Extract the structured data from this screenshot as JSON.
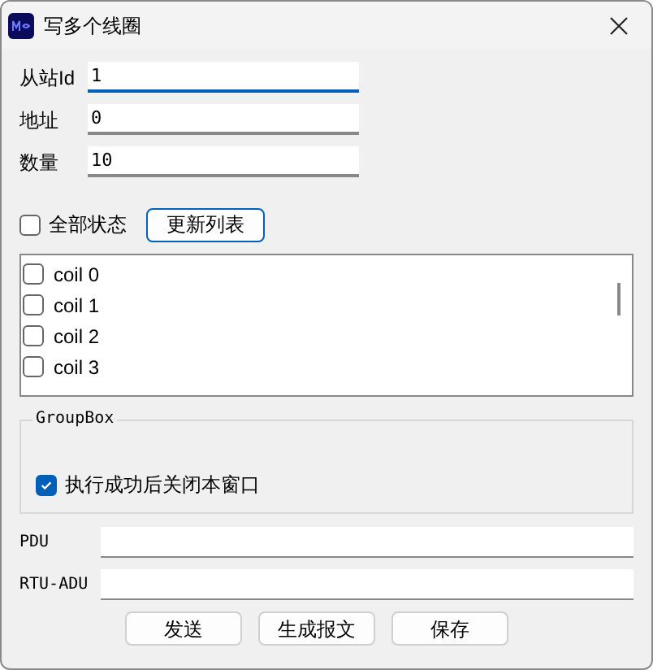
{
  "window": {
    "title": "写多个线圈"
  },
  "fields": [
    {
      "label": "从站Id",
      "value": "1",
      "focused": true
    },
    {
      "label": "地址",
      "value": "0",
      "focused": false
    },
    {
      "label": "数量",
      "value": "10",
      "focused": false
    }
  ],
  "all_state": {
    "label": "全部状态",
    "checked": false
  },
  "refresh_button": "更新列表",
  "coils": [
    {
      "label": "coil 0",
      "checked": false
    },
    {
      "label": "coil 1",
      "checked": false
    },
    {
      "label": "coil 2",
      "checked": false
    },
    {
      "label": "coil 3",
      "checked": false
    }
  ],
  "group": {
    "title": "GroupBox",
    "option": {
      "label": "执行成功后关闭本窗口",
      "checked": true
    }
  },
  "outputs": [
    {
      "label": "PDU"
    },
    {
      "label": "RTU-ADU"
    }
  ],
  "buttons": [
    "发送",
    "生成报文",
    "保存"
  ]
}
